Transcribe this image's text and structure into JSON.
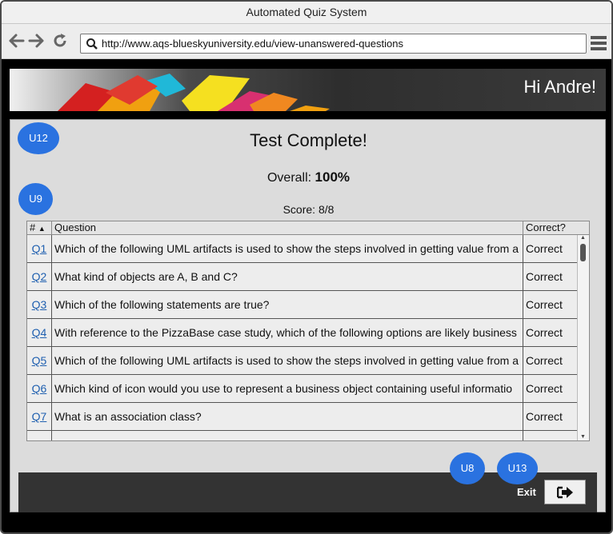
{
  "window": {
    "title": "Automated Quiz System"
  },
  "browser": {
    "url": "http://www.aqs-blueskyuniversity.edu/view-unanswered-questions"
  },
  "header": {
    "greeting": "Hi Andre!"
  },
  "results": {
    "title": "Test Complete!",
    "overall_label": "Overall:",
    "overall_value": "100%",
    "score_label": "Score:",
    "score_value": "8/8"
  },
  "table": {
    "columns": [
      "#",
      "Question",
      "Correct?"
    ],
    "rows": [
      {
        "num": "Q1",
        "question": "Which of the following UML artifacts is used to show the steps involved in getting value from a",
        "correct": "Correct"
      },
      {
        "num": "Q2",
        "question": "What kind of objects are A, B and C?",
        "correct": "Correct"
      },
      {
        "num": "Q3",
        "question": "Which of the following statements are true?",
        "correct": "Correct"
      },
      {
        "num": "Q4",
        "question": "With reference to the PizzaBase case study, which of the following options are likely business",
        "correct": "Correct"
      },
      {
        "num": "Q5",
        "question": "Which of the following UML artifacts is used to show the steps involved in getting value from a",
        "correct": "Correct"
      },
      {
        "num": "Q6",
        "question": "Which kind of icon would you use to represent a business object containing useful informatio",
        "correct": "Correct"
      },
      {
        "num": "Q7",
        "question": "What is an association class?",
        "correct": "Correct"
      }
    ]
  },
  "footer": {
    "exit_label": "Exit"
  },
  "badges": {
    "u12": "U12",
    "u9": "U9",
    "u8": "U8",
    "u13": "U13"
  },
  "colors": {
    "badge": "#2a72e0",
    "link": "#2060b0"
  }
}
